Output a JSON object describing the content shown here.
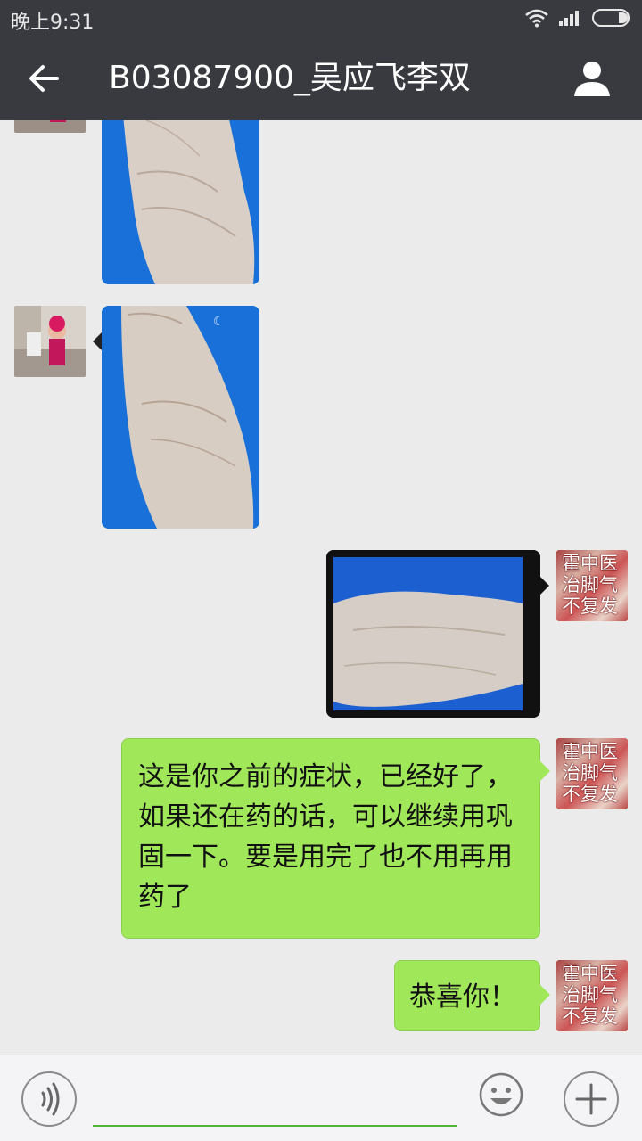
{
  "status_bar": {
    "time": "晚上9:31"
  },
  "header": {
    "title": "B03087900_吴应飞李双",
    "back_icon": "arrow-left-icon",
    "profile_icon": "person-icon"
  },
  "contact_avatar_text": [
    "霍中医",
    "治脚气",
    "不复发"
  ],
  "messages": [
    {
      "from": "other",
      "type": "image",
      "content": "foot photo (partially scrolled)"
    },
    {
      "from": "other",
      "type": "image",
      "content": "foot photo"
    },
    {
      "from": "me",
      "type": "image",
      "content": "foot photo"
    },
    {
      "from": "me",
      "type": "text",
      "text": "这是你之前的症状，已经好了，如果还在药的话，可以继续用巩固一下。要是用完了也不用再用药了"
    },
    {
      "from": "me",
      "type": "text",
      "text": "恭喜你！"
    }
  ],
  "input_bar": {
    "input_value": "",
    "voice_icon": "voice-icon",
    "emoji_icon": "emoji-icon",
    "plus_icon": "plus-icon"
  },
  "colors": {
    "bar": "#393a3f",
    "chat_bg": "#ebebeb",
    "my_bubble": "#a0e75a",
    "input_underline": "#4fb536"
  }
}
